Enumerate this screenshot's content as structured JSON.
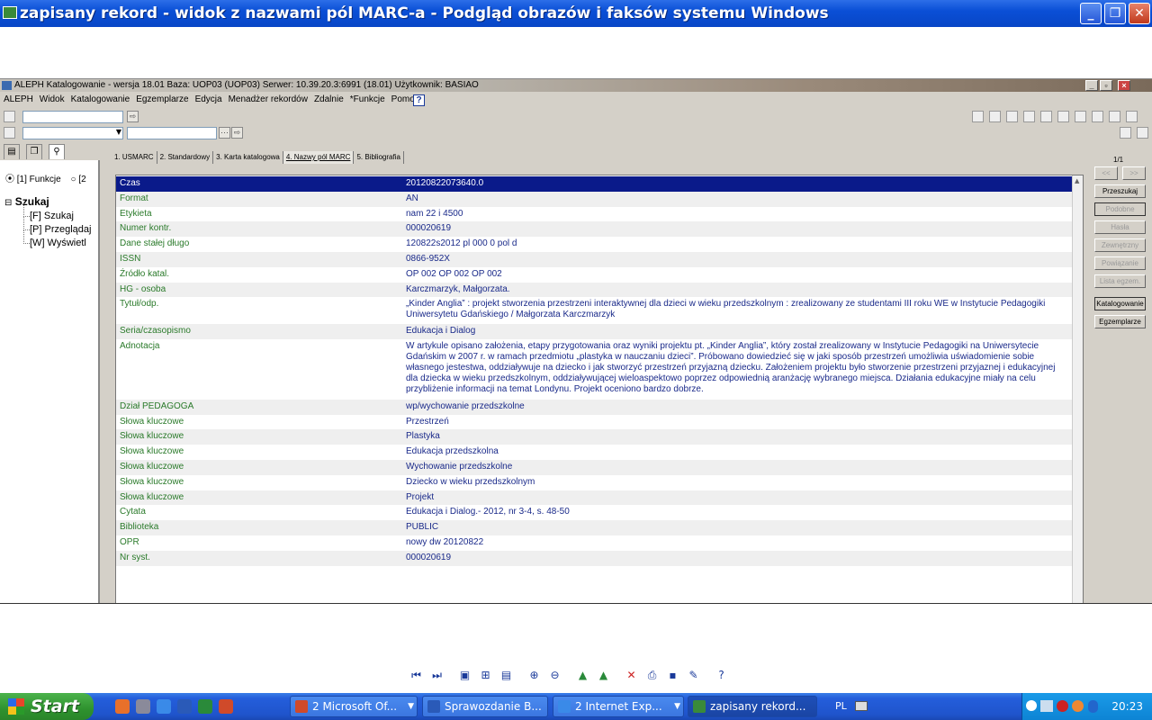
{
  "viewer": {
    "title": "zapisany rekord - widok z nazwami pól MARC-a - Podgląd obrazów i faksów systemu Windows"
  },
  "aleph": {
    "title": "ALEPH Katalogowanie - wersja 18.01  Baza:  UOP03 (UOP03)  Serwer:  10.39.20.3:6991 (18.01)  Użytkownik:  BASIAO",
    "menu": [
      "ALEPH",
      "Widok",
      "Katalogowanie",
      "Egzemplarze",
      "Edycja",
      "Menadżer rekordów",
      "Zdalnie",
      "*Funkcje",
      "Pomoc"
    ],
    "left": {
      "radio1": "[1] Funkcje",
      "radio2": "[2",
      "tree_root": "Szukaj",
      "tree_items": [
        "[F] Szukaj",
        "[P] Przeglądaj",
        "[W] Wyświetl"
      ]
    },
    "tabs": [
      "1. USMARC",
      "2. Standardowy",
      "3. Karta katalogowa",
      "4. Nazwy pól MARC",
      "5. Bibliografia"
    ],
    "active_tab": "4. Nazwy pól MARC",
    "page_counter": "1/1",
    "nav_prev": "<<",
    "nav_next": ">>",
    "side_buttons": [
      "Przeszukaj",
      "Podobne",
      "Hasła",
      "Zewnętrzny",
      "Powiązanie",
      "Lista egzem.",
      "Katalogowanie",
      "Egzemplarze"
    ],
    "record": [
      {
        "label": "Czas",
        "value": "20120822073640.0"
      },
      {
        "label": "Format",
        "value": "AN"
      },
      {
        "label": "Etykieta",
        "value": "nam  22     i 4500"
      },
      {
        "label": "Numer kontr.",
        "value": "000020619"
      },
      {
        "label": "Dane stałej długo",
        "value": "120822s2012     pl             000 0 pol d"
      },
      {
        "label": "ISSN",
        "value": "0866-952X"
      },
      {
        "label": "Źródło katal.",
        "value": "OP 002 OP 002 OP 002"
      },
      {
        "label": "HG - osoba",
        "value": "Karczmarzyk, Małgorzata."
      },
      {
        "label": "Tytuł/odp.",
        "value": "„Kinder Anglia” : projekt stworzenia przestrzeni interaktywnej dla dzieci w wieku przedszkolnym : zrealizowany ze studentami III roku WE w Instytucie Pedagogiki Uniwersytetu Gdańskiego / Małgorzata Karczmarzyk"
      },
      {
        "label": "Seria/czasopismo",
        "value": "Edukacja i Dialog"
      },
      {
        "label": "Adnotacja",
        "value": "W artykule opisano założenia, etapy przygotowania oraz wyniki projektu pt. „Kinder Anglia”, który został zrealizowany w Instytucie Pedagogiki na Uniwersytecie Gdańskim w 2007 r. w ramach przedmiotu „plastyka w nauczaniu dzieci”. Próbowano dowiedzieć się w jaki sposób przestrzeń umożliwia uświadomienie sobie własnego jestestwa, oddziaływuje na dziecko i jak stworzyć przestrzeń przyjazną dziecku. Założeniem projektu było stworzenie przestrzeni przyjaznej i edukacyjnej dla dziecka w wieku przedszkolnym, oddziaływującej wieloaspektowo poprzez odpowiednią aranżację wybranego miejsca. Działania edukacyjne miały na celu przybliżenie informacji na temat Londynu. Projekt oceniono bardzo dobrze."
      },
      {
        "label": "Dział PEDAGOGA",
        "value": "wp/wychowanie przedszkolne"
      },
      {
        "label": "Słowa kluczowe",
        "value": "Przestrzeń"
      },
      {
        "label": "Słowa kluczowe",
        "value": "Plastyka"
      },
      {
        "label": "Słowa kluczowe",
        "value": "Edukacja przedszkolna"
      },
      {
        "label": "Słowa kluczowe",
        "value": "Wychowanie przedszkolne"
      },
      {
        "label": "Słowa kluczowe",
        "value": "Dziecko w wieku przedszkolnym"
      },
      {
        "label": "Słowa kluczowe",
        "value": "Projekt"
      },
      {
        "label": "Cytata",
        "value": "Edukacja i Dialog.- 2012, nr 3-4, s. 48-50"
      },
      {
        "label": "Biblioteka",
        "value": "PUBLIC"
      },
      {
        "label": "OPR",
        "value": "nowy dw 20120822"
      },
      {
        "label": "Nr syst.",
        "value": "000020619"
      }
    ]
  },
  "viewer_toolbar": [
    {
      "icon": "previous-image-icon",
      "glyph": "⏮"
    },
    {
      "icon": "next-image-icon",
      "glyph": "⏭"
    },
    {
      "icon": "best-fit-icon",
      "glyph": "▣"
    },
    {
      "icon": "actual-size-icon",
      "glyph": "⊞"
    },
    {
      "icon": "slideshow-icon",
      "glyph": "▤"
    },
    {
      "icon": "zoom-in-icon",
      "glyph": "⊕"
    },
    {
      "icon": "zoom-out-icon",
      "glyph": "⊖"
    },
    {
      "icon": "rotate-clockwise-icon",
      "glyph": "▲"
    },
    {
      "icon": "rotate-counterclockwise-icon",
      "glyph": "▲"
    },
    {
      "icon": "delete-icon",
      "glyph": "✕"
    },
    {
      "icon": "print-icon",
      "glyph": "⎙"
    },
    {
      "icon": "save-icon",
      "glyph": "▪"
    },
    {
      "icon": "edit-icon",
      "glyph": "✎"
    },
    {
      "icon": "help-icon",
      "glyph": "?"
    }
  ],
  "taskbar": {
    "start": "Start",
    "buttons": [
      "2 Microsoft Of...",
      "Sprawozdanie B...",
      "2 Internet Exp...",
      "zapisany rekord..."
    ],
    "language": "PL",
    "clock": "20:23"
  },
  "colors": {
    "selected_row": "#0a1a8a",
    "label_green": "#2a7a2a",
    "value_blue": "#1a2a8a",
    "xp_blue": "#0a4fd6"
  }
}
